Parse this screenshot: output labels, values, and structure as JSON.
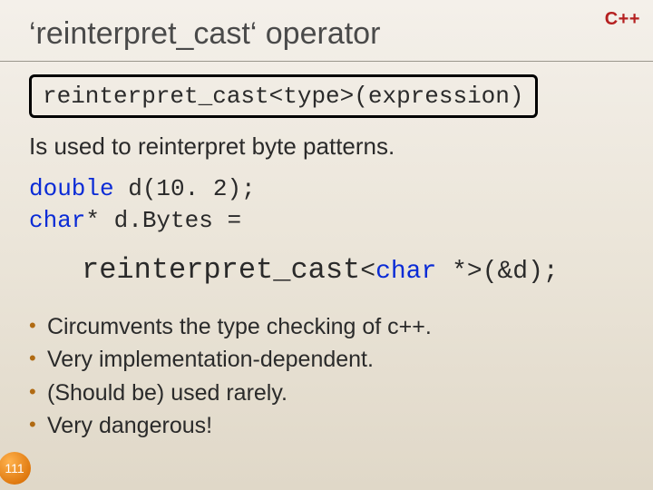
{
  "lang_badge": "C++",
  "title": "‘reinterpret_cast‘ operator",
  "syntax": "reinterpret_cast<type>(expression)",
  "description": "Is used to reinterpret byte patterns.",
  "code": {
    "kw1": "double",
    "rest1": " d(10. 2);",
    "kw2": "char",
    "rest2": "* d.Bytes ="
  },
  "example": {
    "big": "reinterpret_cast",
    "lt": "<",
    "kw": "char",
    "tail": " *>(&d);"
  },
  "bullets": [
    "Circumvents the type checking of c++.",
    "Very implementation-dependent.",
    "(Should be) used rarely.",
    "Very dangerous!"
  ],
  "page_number": "111"
}
